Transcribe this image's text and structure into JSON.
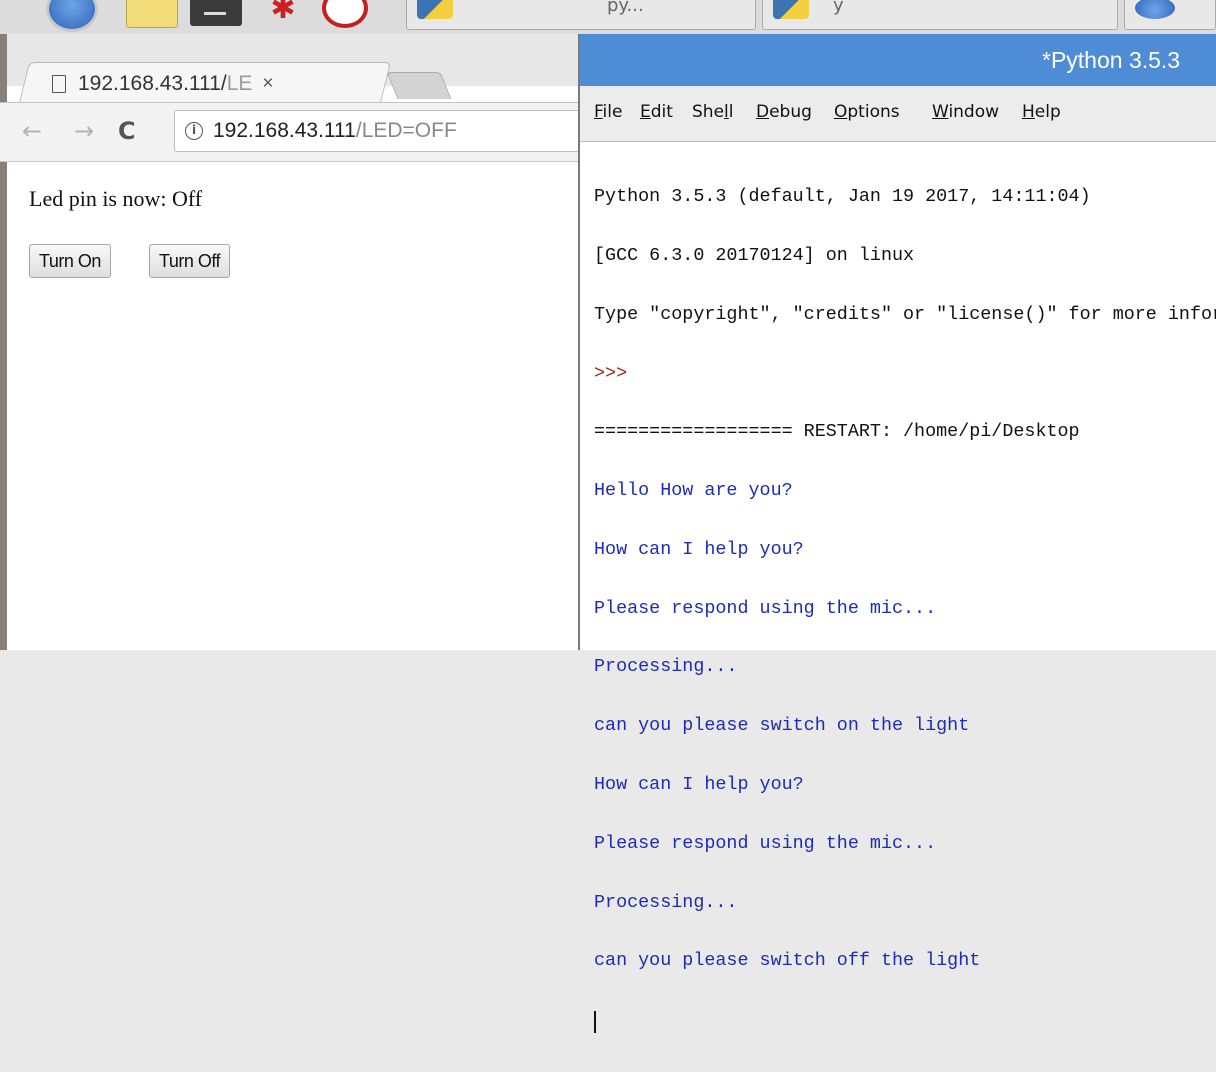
{
  "taskbar": {
    "windows": [
      {
        "label": "py..."
      },
      {
        "label": "y"
      },
      {
        "label": ""
      }
    ]
  },
  "browser": {
    "tab": {
      "title_host": "192.168.43.111/",
      "title_fade": "LE",
      "close_glyph": "×"
    },
    "nav": {
      "back_glyph": "←",
      "forward_glyph": "→",
      "reload_glyph": "C"
    },
    "omnibox": {
      "info_glyph": "i",
      "url_host": "192.168.43.111",
      "url_path": "/LED=OFF"
    },
    "page": {
      "status_text": "Led pin is now: Off",
      "buttons": {
        "on": "Turn On",
        "off": "Turn Off"
      }
    }
  },
  "shell": {
    "title": "*Python 3.5.3",
    "menu": [
      {
        "first": "F",
        "rest": "ile"
      },
      {
        "first": "E",
        "rest": "dit"
      },
      {
        "pre": "She",
        "first": "l",
        "rest": "l"
      },
      {
        "first": "D",
        "rest": "ebug"
      },
      {
        "first": "O",
        "rest": "ptions"
      },
      {
        "first": "W",
        "rest": "indow"
      },
      {
        "first": "H",
        "rest": "elp"
      }
    ],
    "console": [
      {
        "text": "Python 3.5.3 (default, Jan 19 2017, 14:11:04)",
        "color": "black"
      },
      {
        "text": "[GCC 6.3.0 20170124] on linux",
        "color": "black"
      },
      {
        "text": "Type \"copyright\", \"credits\" or \"license()\" for more information.",
        "color": "black"
      },
      {
        "text": ">>> ",
        "color": "prompt"
      },
      {
        "text": "================== RESTART: /home/pi/Desktop",
        "color": "black"
      },
      {
        "text": "Hello How are you?",
        "color": "blue"
      },
      {
        "text": "How can I help you?",
        "color": "blue"
      },
      {
        "text": "Please respond using the mic...",
        "color": "blue"
      },
      {
        "text": "Processing...",
        "color": "blue"
      },
      {
        "text": "can you please switch on the light",
        "color": "blue"
      },
      {
        "text": "How can I help you?",
        "color": "blue"
      },
      {
        "text": "Please respond using the mic...",
        "color": "blue"
      },
      {
        "text": "Processing...",
        "color": "blue"
      },
      {
        "text": "can you please switch off the light",
        "color": "blue"
      }
    ]
  },
  "colors": {
    "shell_titlebar": "#4f8cd6",
    "console_output_blue": "#1e2bb8",
    "prompt_red": "#9a2a1a"
  }
}
